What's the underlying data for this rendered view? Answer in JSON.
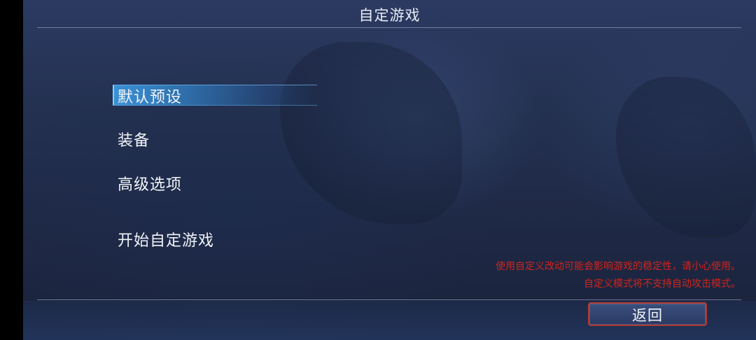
{
  "header": {
    "title": "自定游戏"
  },
  "menu": {
    "items": [
      {
        "label": "默认预设",
        "selected": true
      },
      {
        "label": "装备",
        "selected": false
      },
      {
        "label": "高级选项",
        "selected": false
      },
      {
        "label": "开始自定游戏",
        "selected": false
      }
    ]
  },
  "warning": {
    "line1": "使用自定义改动可能会影响游戏的稳定性，请小心使用。",
    "line2": "自定义模式将不支持自动攻击模式。",
    "color": "#d0241e"
  },
  "footer": {
    "back_label": "返回"
  },
  "colors": {
    "background": "#23304f",
    "highlight": "#3c96dc",
    "button_border": "#b23a34"
  }
}
